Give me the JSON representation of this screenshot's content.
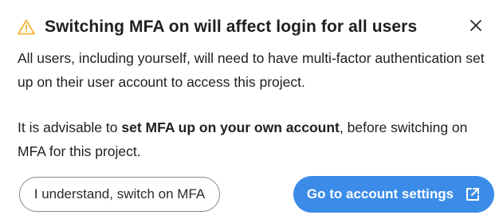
{
  "dialog": {
    "title": "Switching MFA on will affect login for all users",
    "icons": {
      "warning": "warning-triangle-icon",
      "close": "close-icon",
      "external": "external-link-icon"
    },
    "colors": {
      "warning": "#f3b23a",
      "primary": "#3b8ce8",
      "text": "#1f1f1f"
    },
    "paragraph1": "All users, including yourself, will need to have multi-factor authentication set up on their user account to access this project.",
    "paragraph2": {
      "before": "It is advisable to ",
      "bold": "set MFA up on your own account",
      "after": ", before switching on MFA for this project."
    },
    "buttons": {
      "secondary": "I understand, switch on MFA",
      "primary": "Go to account settings"
    }
  }
}
